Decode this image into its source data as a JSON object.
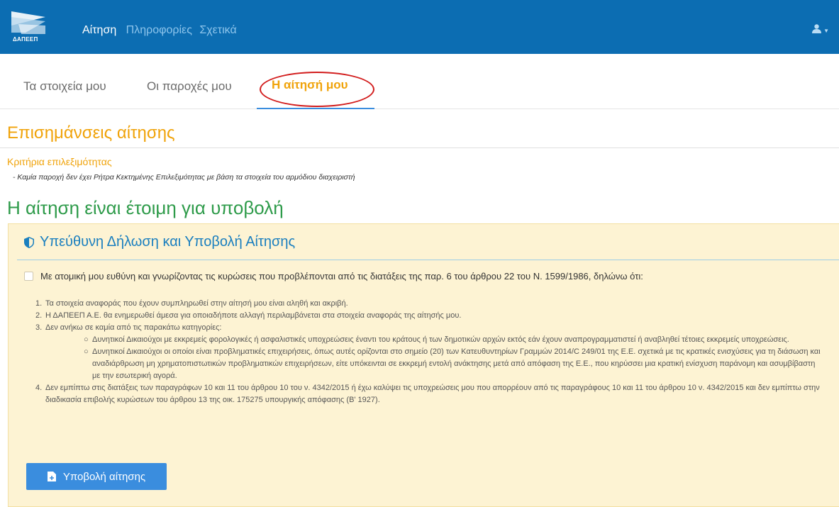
{
  "navbar": {
    "logo_text": "ΔΑΠΕΕΠ",
    "links": [
      {
        "label": "Αίτηση",
        "active": true
      },
      {
        "label": "Πληροφορίες",
        "active": false
      },
      {
        "label": "Σχετικά",
        "active": false
      }
    ],
    "user_icon": "user-icon"
  },
  "tabs": [
    {
      "label": "Τα στοιχεία μου"
    },
    {
      "label": "Οι παροχές μου"
    },
    {
      "label": "Η αίτησή μου",
      "active": true
    }
  ],
  "notice": {
    "title": "Επισημάνσεις αίτησης",
    "criteria_title": "Κριτήρια επιλεξιμότητας",
    "criteria_item": "- Καμία παροχή δεν έχει Ρήτρα Κεκτημένης Επιλεξιμότητας με βάση τα στοιχεία του αρμόδιου διαχειριστή"
  },
  "ready_title": "Η αίτηση είναι έτοιμη για υποβολή",
  "panel": {
    "heading": "Υπεύθυνη Δήλωση και Υποβολή Αίτησης",
    "declaration": "Με ατομική μου ευθύνη και γνωρίζοντας τις κυρώσεις που προβλέπονται από τις διατάξεις της παρ. 6 του άρθρου 22 του Ν. 1599/1986, δηλώνω ότι:",
    "items": [
      {
        "num": "1.",
        "text": "Τα στοιχεία αναφοράς που έχουν συμπληρωθεί στην αίτησή μου είναι αληθή και ακριβή."
      },
      {
        "num": "2.",
        "text": "Η ΔΑΠΕΕΠ Α.Ε. θα ενημερωθεί άμεσα για οποιαδήποτε αλλαγή περιλαμβάνεται στα στοιχεία αναφοράς της αίτησής μου."
      },
      {
        "num": "3.",
        "text": "Δεν ανήκω σε καμία από τις παρακάτω κατηγορίες:"
      }
    ],
    "sub_items": [
      "Δυνητικοί Δικαιούχοι με εκκρεμείς φορολογικές ή ασφαλιστικές υποχρεώσεις έναντι του κράτους ή των δημοτικών αρχών εκτός εάν έχουν αναπρογραμματιστεί ή αναβληθεί τέτοιες εκκρεμείς υποχρεώσεις.",
      "Δυνητικοί Δικαιούχοι οι οποίοι είναι προβληματικές επιχειρήσεις, όπως αυτές ορίζονται στο σημείο (20) των Κατευθυντηρίων Γραμμών 2014/C 249/01 της Ε.Ε. σχετικά με τις κρατικές ενισχύσεις για τη διάσωση και αναδιάρθρωση μη χρηματοπιστωτικών προβληματικών επιχειρήσεων, είτε υπόκεινται σε εκκρεμή εντολή ανάκτησης μετά από απόφαση της Ε.Ε., που κηρύσσει μια κρατική ενίσχυση παράνομη και ασυμβίβαστη με την εσωτερική αγορά."
    ],
    "item4": {
      "num": "4.",
      "text": "Δεν εμπίπτω στις διατάξεις των παραγράφων 10 και 11 του άρθρου 10 του ν. 4342/2015 ή έχω καλύψει τις υποχρεώσεις μου που απορρέουν από τις παραγράφους 10 και 11 του άρθρου 10 ν. 4342/2015 και δεν εμπίπτω στην διαδικασία επιβολής κυρώσεων του άρθρου 13 της οικ. 175275 υπουργικής απόφασης (Β' 1927)."
    },
    "submit_label": "Υποβολή αίτησης"
  }
}
